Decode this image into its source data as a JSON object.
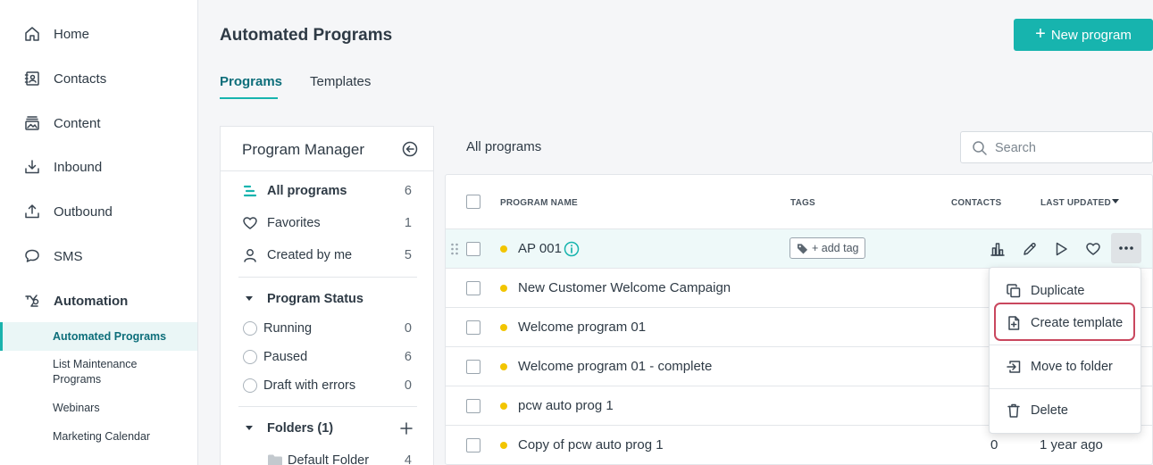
{
  "nav": {
    "items": [
      {
        "label": "Home",
        "icon": "home-icon"
      },
      {
        "label": "Contacts",
        "icon": "contacts-icon"
      },
      {
        "label": "Content",
        "icon": "content-icon"
      },
      {
        "label": "Inbound",
        "icon": "inbound-icon"
      },
      {
        "label": "Outbound",
        "icon": "outbound-icon"
      },
      {
        "label": "SMS",
        "icon": "sms-icon"
      },
      {
        "label": "Automation",
        "icon": "automation-icon"
      }
    ],
    "sub_items": [
      {
        "label": "Automated Programs",
        "active": true
      },
      {
        "label": "List Maintenance Programs"
      },
      {
        "label": "Webinars"
      },
      {
        "label": "Marketing Calendar"
      }
    ]
  },
  "header": {
    "title": "Automated Programs",
    "new_program_label": "New program",
    "tabs": [
      {
        "label": "Programs",
        "active": true
      },
      {
        "label": "Templates"
      }
    ]
  },
  "program_manager": {
    "title": "Program Manager",
    "filters": [
      {
        "label": "All programs",
        "count": "6",
        "icon": "list-icon",
        "active": true
      },
      {
        "label": "Favorites",
        "count": "1",
        "icon": "heart-icon"
      },
      {
        "label": "Created by me",
        "count": "5",
        "icon": "user-icon"
      }
    ],
    "status_title": "Program Status",
    "statuses": [
      {
        "label": "Running",
        "count": "0"
      },
      {
        "label": "Paused",
        "count": "6"
      },
      {
        "label": "Draft with errors",
        "count": "0"
      }
    ],
    "folders_title": "Folders (1)",
    "folders": [
      {
        "label": "Default Folder",
        "count": "4"
      }
    ]
  },
  "programs": {
    "title": "All programs",
    "search_placeholder": "Search",
    "columns": {
      "name": "PROGRAM NAME",
      "tags": "TAGS",
      "contacts": "CONTACTS",
      "updated": "LAST UPDATED"
    },
    "add_tag_label": "+ add tag",
    "rows": [
      {
        "name": "AP 001",
        "contacts": "",
        "updated": "",
        "status_color": "#f2c500"
      },
      {
        "name": "New Customer Welcome Campaign",
        "contacts": "",
        "updated": "",
        "status_color": "#f2c500"
      },
      {
        "name": "Welcome program 01",
        "contacts": "",
        "updated": "",
        "status_color": "#f2c500"
      },
      {
        "name": "Welcome program 01 - complete",
        "contacts": "",
        "updated": "",
        "status_color": "#f2c500"
      },
      {
        "name": "pcw auto prog 1",
        "contacts": "",
        "updated": "",
        "status_color": "#f2c500"
      },
      {
        "name": "Copy of pcw auto prog 1",
        "contacts": "0",
        "updated": "1 year ago",
        "status_color": "#f2c500"
      }
    ]
  },
  "menu": {
    "items": [
      {
        "label": "Duplicate",
        "icon": "duplicate-icon"
      },
      {
        "label": "Create template",
        "icon": "create-template-icon"
      },
      {
        "label": "Move to folder",
        "icon": "move-folder-icon"
      },
      {
        "label": "Delete",
        "icon": "trash-icon"
      }
    ]
  },
  "colors": {
    "accent": "#17b4ae",
    "highlight": "#c9475e",
    "status_paused": "#f2c500"
  }
}
